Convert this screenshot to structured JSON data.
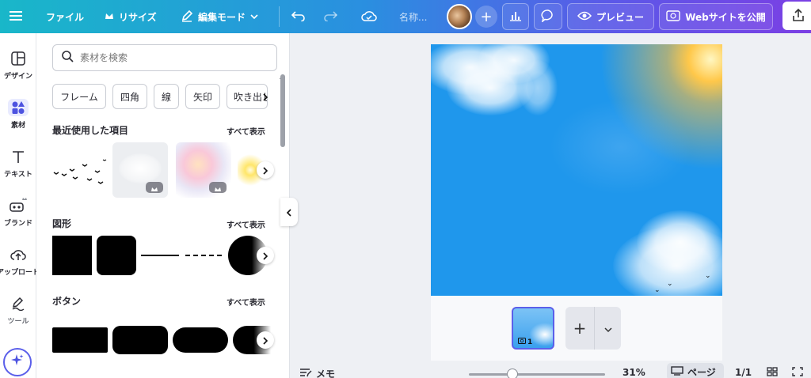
{
  "topbar": {
    "file_label": "ファイル",
    "resize_label": "リサイズ",
    "edit_mode_label": "編集モード",
    "name_placeholder": "名称...",
    "preview_label": "プレビュー",
    "publish_label": "Webサイトを公開"
  },
  "rail": {
    "items": [
      {
        "label": "デザイン",
        "icon": "layout-icon"
      },
      {
        "label": "素材",
        "icon": "elements-icon"
      },
      {
        "label": "テキスト",
        "icon": "text-icon"
      },
      {
        "label": "ブランド",
        "icon": "brand-icon"
      },
      {
        "label": "アップロード",
        "icon": "upload-icon"
      },
      {
        "label": "ツール",
        "icon": "draw-icon"
      }
    ]
  },
  "panel": {
    "search_placeholder": "素材を検索",
    "chips": [
      "フレーム",
      "四角",
      "線",
      "矢印",
      "吹き出し"
    ],
    "recent_title": "最近使用した項目",
    "shapes_title": "図形",
    "buttons_title": "ボタン",
    "see_all": "すべて表示"
  },
  "filmstrip": {
    "page_number": "1"
  },
  "footer": {
    "notes_label": "メモ",
    "zoom": "31%",
    "page_label": "ページ",
    "page_count": "1/1"
  },
  "colors": {
    "accent": "#5b5fea",
    "sky": "#1f97ec"
  }
}
